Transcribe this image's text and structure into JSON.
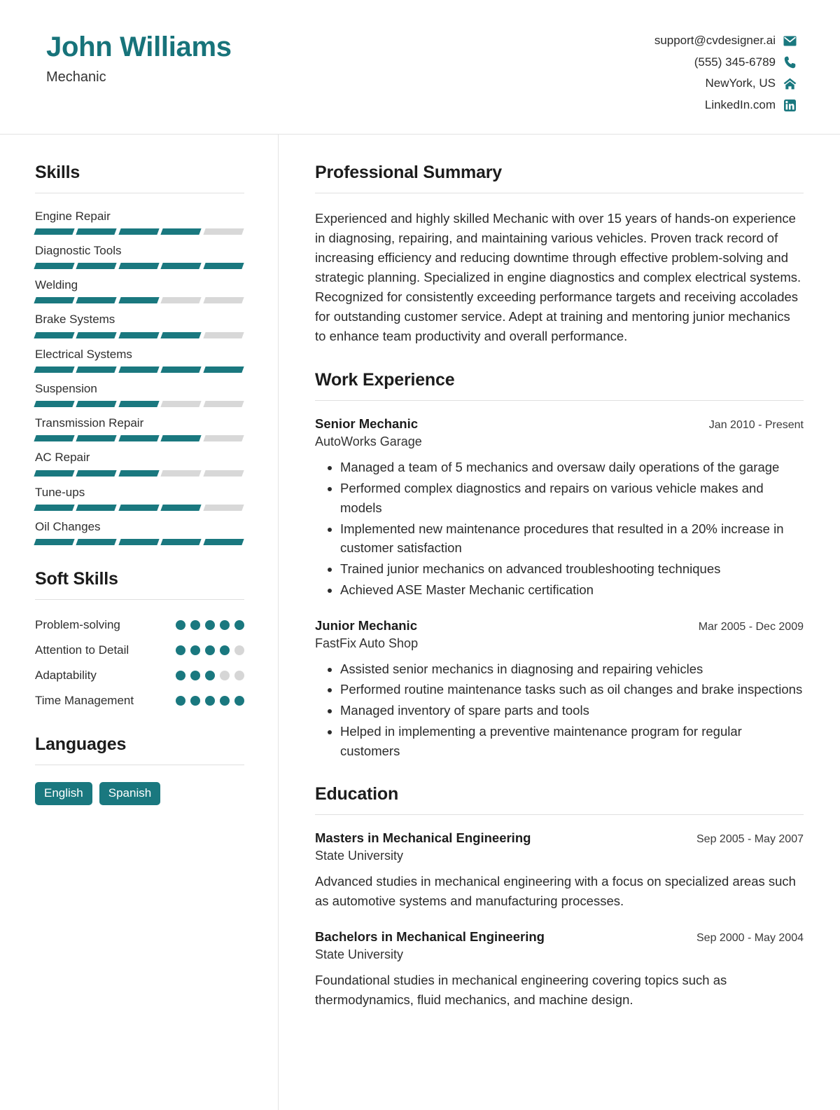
{
  "header": {
    "name": "John Williams",
    "job_title": "Mechanic",
    "accent_color": "#17737a",
    "contacts": [
      {
        "value": "support@cvdesigner.ai",
        "icon": "email-icon"
      },
      {
        "value": "(555) 345-6789",
        "icon": "phone-icon"
      },
      {
        "value": "NewYork, US",
        "icon": "home-icon"
      },
      {
        "value": "LinkedIn.com",
        "icon": "linkedin-icon"
      }
    ]
  },
  "sidebar": {
    "skills": {
      "title": "Skills",
      "max_level": 5,
      "items": [
        {
          "label": "Engine Repair",
          "level": 4
        },
        {
          "label": "Diagnostic Tools",
          "level": 5
        },
        {
          "label": "Welding",
          "level": 3
        },
        {
          "label": "Brake Systems",
          "level": 4
        },
        {
          "label": "Electrical Systems",
          "level": 5
        },
        {
          "label": "Suspension",
          "level": 3
        },
        {
          "label": "Transmission Repair",
          "level": 4
        },
        {
          "label": "AC Repair",
          "level": 3
        },
        {
          "label": "Tune-ups",
          "level": 4
        },
        {
          "label": "Oil Changes",
          "level": 5
        }
      ]
    },
    "soft_skills": {
      "title": "Soft Skills",
      "max_level": 5,
      "items": [
        {
          "label": "Problem-solving",
          "level": 5
        },
        {
          "label": "Attention to Detail",
          "level": 4
        },
        {
          "label": "Adaptability",
          "level": 3
        },
        {
          "label": "Time Management",
          "level": 5
        }
      ]
    },
    "languages": {
      "title": "Languages",
      "items": [
        "English",
        "Spanish"
      ]
    }
  },
  "main": {
    "summary": {
      "title": "Professional Summary",
      "text": "Experienced and highly skilled Mechanic with over 15 years of hands-on experience in diagnosing, repairing, and maintaining various vehicles. Proven track record of increasing efficiency and reducing downtime through effective problem-solving and strategic planning. Specialized in engine diagnostics and complex electrical systems. Recognized for consistently exceeding performance targets and receiving accolades for outstanding customer service. Adept at training and mentoring junior mechanics to enhance team productivity and overall performance."
    },
    "experience": {
      "title": "Work Experience",
      "entries": [
        {
          "role": "Senior Mechanic",
          "company": "AutoWorks Garage",
          "date": "Jan 2010 - Present",
          "bullets": [
            "Managed a team of 5 mechanics and oversaw daily operations of the garage",
            "Performed complex diagnostics and repairs on various vehicle makes and models",
            "Implemented new maintenance procedures that resulted in a 20% increase in customer satisfaction",
            "Trained junior mechanics on advanced troubleshooting techniques",
            "Achieved ASE Master Mechanic certification"
          ]
        },
        {
          "role": "Junior Mechanic",
          "company": "FastFix Auto Shop",
          "date": "Mar 2005 - Dec 2009",
          "bullets": [
            "Assisted senior mechanics in diagnosing and repairing vehicles",
            "Performed routine maintenance tasks such as oil changes and brake inspections",
            "Managed inventory of spare parts and tools",
            "Helped in implementing a preventive maintenance program for regular customers"
          ]
        }
      ]
    },
    "education": {
      "title": "Education",
      "entries": [
        {
          "degree": "Masters in Mechanical Engineering",
          "school": "State University",
          "date": "Sep 2005 - May 2007",
          "description": "Advanced studies in mechanical engineering with a focus on specialized areas such as automotive systems and manufacturing processes."
        },
        {
          "degree": "Bachelors in Mechanical Engineering",
          "school": "State University",
          "date": "Sep 2000 - May 2004",
          "description": "Foundational studies in mechanical engineering covering topics such as thermodynamics, fluid mechanics, and machine design."
        }
      ]
    }
  }
}
